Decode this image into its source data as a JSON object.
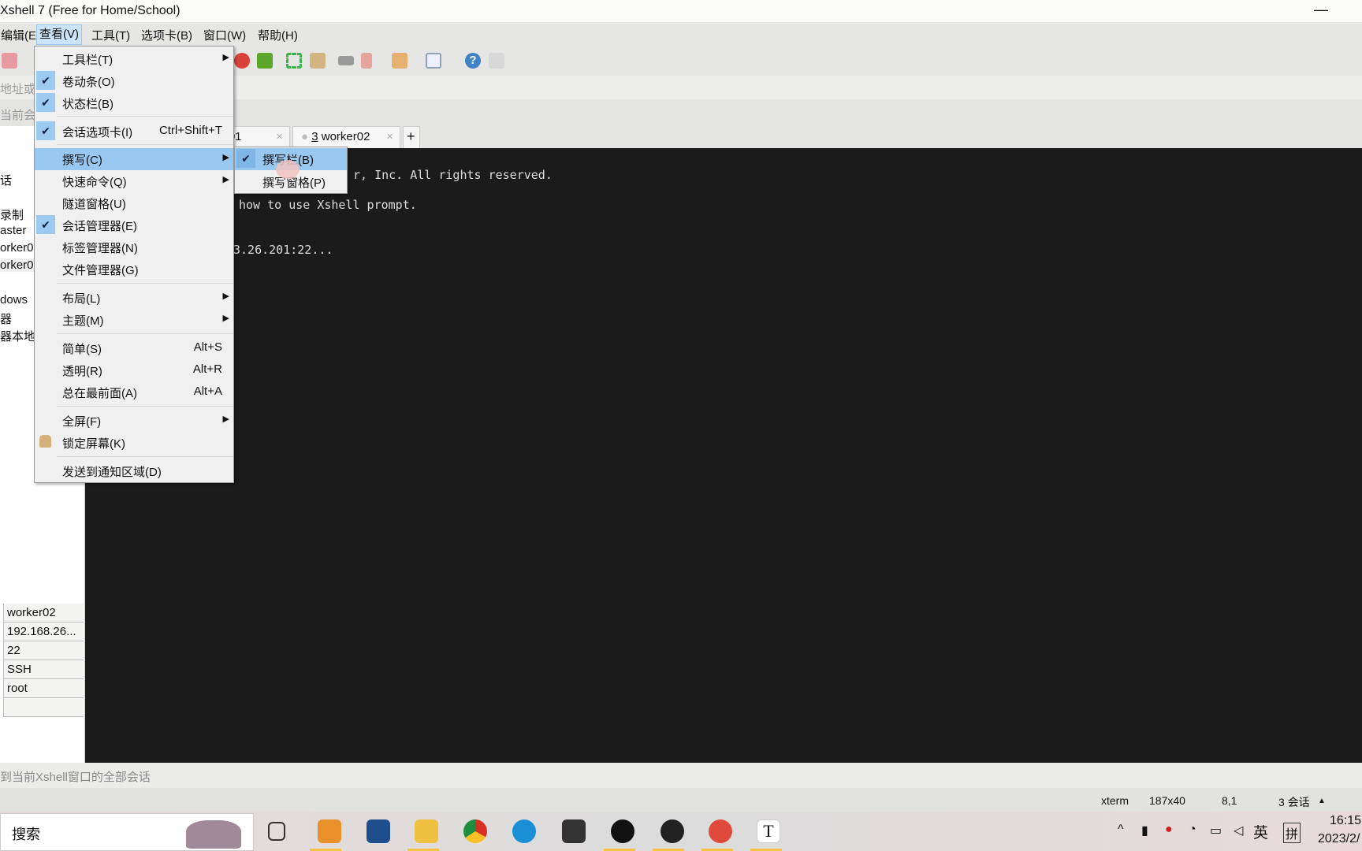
{
  "window": {
    "title": "Xshell 7 (Free for Home/School)",
    "minimize": "—"
  },
  "menubar": [
    "编辑(E)",
    "查看(V)",
    "工具(T)",
    "选项卡(B)",
    "窗口(W)",
    "帮助(H)"
  ],
  "address": {
    "placeholder": "地址或会话"
  },
  "bar2": {
    "text": "当前会话"
  },
  "tabs": [
    {
      "label": "ker01",
      "close": "×"
    },
    {
      "num": "3",
      "label": " worker02",
      "close": "×"
    },
    {
      "label": "+"
    }
  ],
  "left_panel": {
    "items": [
      "话",
      "录制",
      "aster",
      "orker0",
      "orker0",
      "dows",
      "器",
      "器本地"
    ]
  },
  "properties": [
    "worker02",
    "192.168.26...",
    "22",
    "SSH",
    "root",
    ""
  ],
  "terminal": {
    "lines": [
      "r, Inc. All rights reserved.",
      "how to use Xshell prompt.",
      "3.26.201:22..."
    ]
  },
  "hint": "到当前Xshell窗口的全部会话",
  "status": {
    "term": "xterm",
    "size": "187x40",
    "pos": "8,1",
    "sessions": "3 会话",
    "up": "▲"
  },
  "menu": {
    "items": [
      {
        "label": "工具栏(T)",
        "submenu": true
      },
      {
        "label": "卷动条(O)",
        "checked": true
      },
      {
        "label": "状态栏(B)",
        "checked": true
      },
      {
        "label": "会话选项卡(I)",
        "checked": true,
        "shortcut": "Ctrl+Shift+T"
      },
      {
        "label": "撰写(C)",
        "submenu": true,
        "highlighted": true
      },
      {
        "label": "快速命令(Q)",
        "submenu": true
      },
      {
        "label": "隧道窗格(U)"
      },
      {
        "label": "会话管理器(E)",
        "checked": true
      },
      {
        "label": "标签管理器(N)"
      },
      {
        "label": "文件管理器(G)"
      },
      {
        "label": "布局(L)",
        "submenu": true
      },
      {
        "label": "主题(M)",
        "submenu": true
      },
      {
        "label": "简单(S)",
        "shortcut": "Alt+S"
      },
      {
        "label": "透明(R)",
        "shortcut": "Alt+R"
      },
      {
        "label": "总在最前面(A)",
        "shortcut": "Alt+A"
      },
      {
        "label": "全屏(F)",
        "submenu": true
      },
      {
        "label": "锁定屏幕(K)",
        "icon": "lock-icon"
      },
      {
        "label": "发送到通知区域(D)"
      }
    ]
  },
  "submenu": {
    "items": [
      {
        "label": "撰写栏(B)",
        "checked": true
      },
      {
        "label": "撰写窗格(P)"
      }
    ]
  },
  "taskbar": {
    "search": "搜索",
    "tray_lang": "英",
    "tray_ime": "拼",
    "time": "16:15",
    "date": "2023/2/"
  },
  "colors": {
    "menu_highlight": "#98c7ef",
    "terminal_bg": "#1b1b1b"
  }
}
